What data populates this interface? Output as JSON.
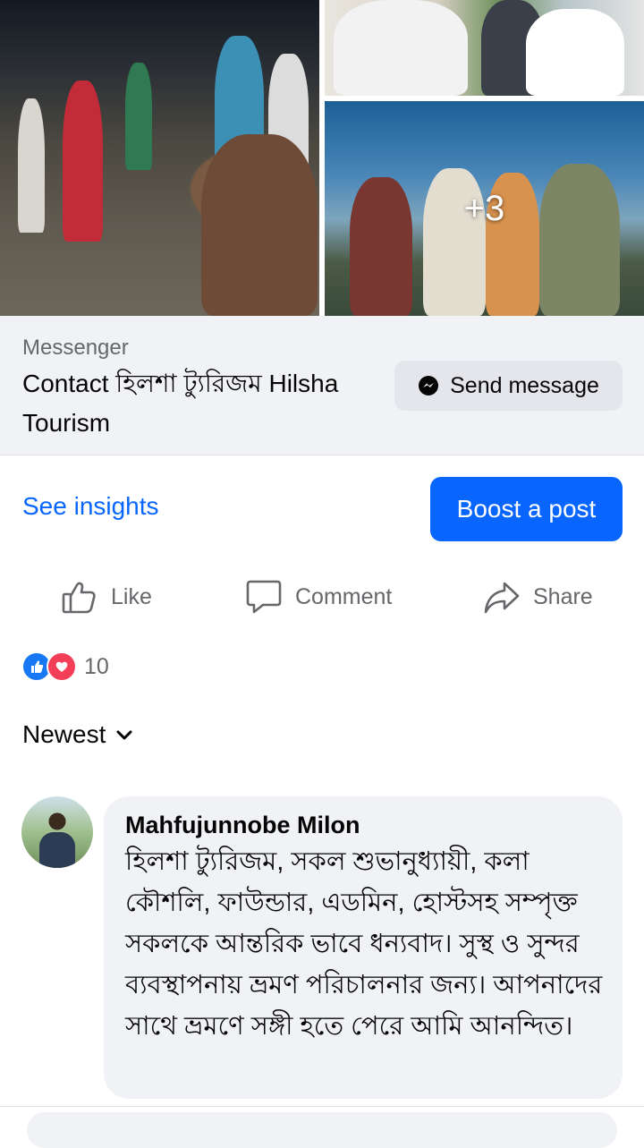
{
  "photos": {
    "more_count": "+3"
  },
  "messenger": {
    "caption": "Messenger",
    "contact_text": "Contact হিলশা ট্যুরিজম Hilsha Tourism",
    "send_label": "Send message"
  },
  "insights_label": "See insights",
  "boost_label": "Boost a post",
  "actions": {
    "like": "Like",
    "comment": "Comment",
    "share": "Share"
  },
  "reactions": {
    "count": "10"
  },
  "sort": {
    "label": "Newest"
  },
  "comment": {
    "author": "Mahfujunnobe Milon",
    "text": "হিলশা ট্যুরিজম, সকল শুভানুধ্যায়ী, কলা কৌশলি, ফাউন্ডার, এডমিন, হোস্টসহ সম্পৃক্ত সকলকে আন্তরিক ভাবে ধন্যবাদ। সুস্থ ও সুন্দর ব্যবস্থাপনায় ভ্রমণ পরিচালনার জন্য। আপনাদের সাথে ভ্রমণে সঙ্গী হতে পেরে আমি আনন্দিত।"
  },
  "colors": {
    "accent": "#0866ff",
    "bubble": "#f0f2f5",
    "muted": "#65676b"
  }
}
